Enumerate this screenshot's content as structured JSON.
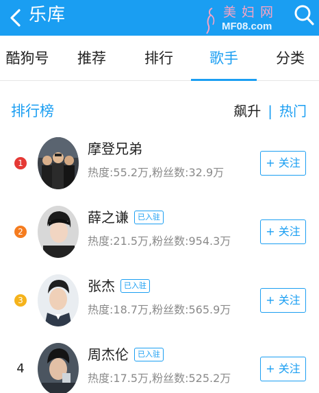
{
  "header": {
    "title": "乐库",
    "back_icon": "chevron-left-icon",
    "search_icon": "search-icon",
    "background": "#1a9ef2",
    "watermark": {
      "cn": "美妇网",
      "en": "MF08.com"
    }
  },
  "tabs": [
    {
      "label": "酷狗号",
      "active": false
    },
    {
      "label": "推荐",
      "active": false
    },
    {
      "label": "排行",
      "active": false
    },
    {
      "label": "歌手",
      "active": true
    },
    {
      "label": "分类",
      "active": false
    }
  ],
  "ranking": {
    "title": "排行榜",
    "sort_current": "飙升",
    "sort_separator": "|",
    "sort_alt": "热门"
  },
  "colors": {
    "accent": "#1a9ef2",
    "rank1": "#e53935",
    "rank2": "#f57c1f",
    "rank3": "#f5b31b"
  },
  "artists": [
    {
      "rank": "1",
      "name": "摩登兄弟",
      "badge": "",
      "stats": "热度:55.2万,粉丝数:32.9万",
      "follow": "+ 关注"
    },
    {
      "rank": "2",
      "name": "薛之谦",
      "badge": "已入驻",
      "stats": "热度:21.5万,粉丝数:954.3万",
      "follow": "+ 关注"
    },
    {
      "rank": "3",
      "name": "张杰",
      "badge": "已入驻",
      "stats": "热度:18.7万,粉丝数:565.9万",
      "follow": "+ 关注"
    },
    {
      "rank": "4",
      "name": "周杰伦",
      "badge": "已入驻",
      "stats": "热度:17.5万,粉丝数:525.2万",
      "follow": "+ 关注"
    }
  ]
}
